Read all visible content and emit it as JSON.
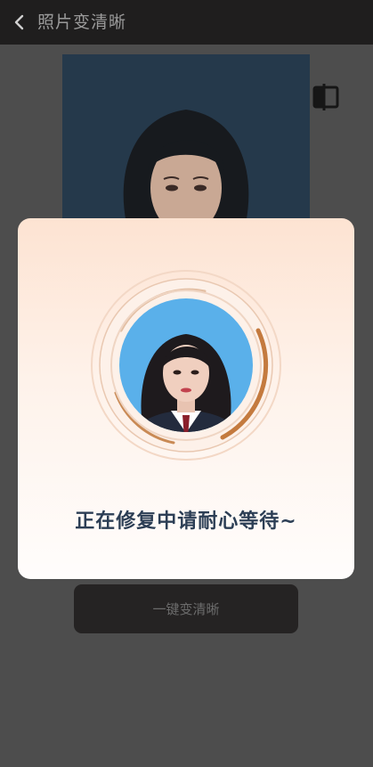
{
  "header": {
    "title": "照片变清晰"
  },
  "main": {
    "action_button_label": "一键变清晰"
  },
  "modal": {
    "status_text": "正在修复中请耐心等待~"
  },
  "colors": {
    "header_bg": "#1f1e1e",
    "page_bg": "#4d4d4d",
    "photo_bg": "#25394b",
    "avatar_bg": "#5ab0ea",
    "ring_accent": "#c47a3e",
    "status_text": "#2c3e55"
  },
  "icons": {
    "back": "chevron-left-icon",
    "compare": "compare-icon"
  }
}
